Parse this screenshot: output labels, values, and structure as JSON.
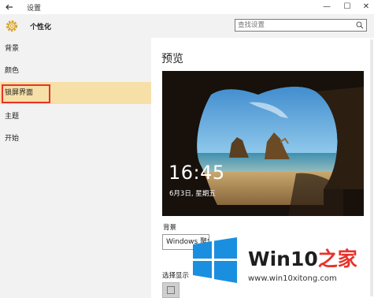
{
  "window": {
    "title": "设置",
    "back_icon": "back-arrow-icon",
    "controls": {
      "minimize": "—",
      "maximize": "☐",
      "close": "✕"
    }
  },
  "header": {
    "icon": "gear-icon",
    "title": "个性化",
    "search": {
      "placeholder": "查找设置",
      "icon": "search-icon"
    }
  },
  "sidebar": {
    "items": [
      {
        "label": "背景",
        "selected": false
      },
      {
        "label": "颜色",
        "selected": false
      },
      {
        "label": "锁屏界面",
        "selected": true,
        "highlighted": true
      },
      {
        "label": "主题",
        "selected": false
      },
      {
        "label": "开始",
        "selected": false
      }
    ],
    "selected_color": "#f7e0a8",
    "highlight_color": "#e8322a"
  },
  "main": {
    "title": "预览",
    "preview": {
      "time": "16:45",
      "date": "6月3日, 星期五"
    },
    "background_label": "背景",
    "background_value": "Windows 聚焦",
    "choose_app_label": "选择显示",
    "app_icon": "calendar-icon"
  },
  "watermark": {
    "brand_prefix": "Win10",
    "brand_accent": "之家",
    "url": "www.win10xitong.com",
    "logo_color": "#1a8fe0"
  }
}
